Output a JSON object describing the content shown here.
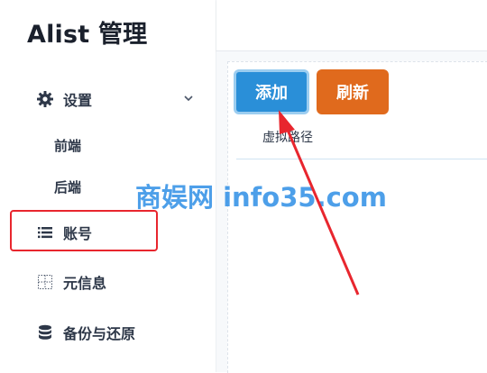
{
  "app": {
    "title": "Alist 管理"
  },
  "sidebar": {
    "settings": {
      "label": "设置",
      "subitems": [
        "前端",
        "后端"
      ]
    },
    "accounts": {
      "label": "账号"
    },
    "meta": {
      "label": "元信息"
    },
    "backup": {
      "label": "备份与还原"
    }
  },
  "toolbar": {
    "add_label": "添加",
    "refresh_label": "刷新"
  },
  "table": {
    "columns": [
      "虚拟路径"
    ]
  },
  "watermark": {
    "text": "商娱网 info35.com"
  },
  "colors": {
    "accent_blue": "#2a8fd8",
    "accent_orange": "#e06a1d",
    "annotation_red": "#e8262e",
    "watermark_blue": "#2e8fe6"
  }
}
